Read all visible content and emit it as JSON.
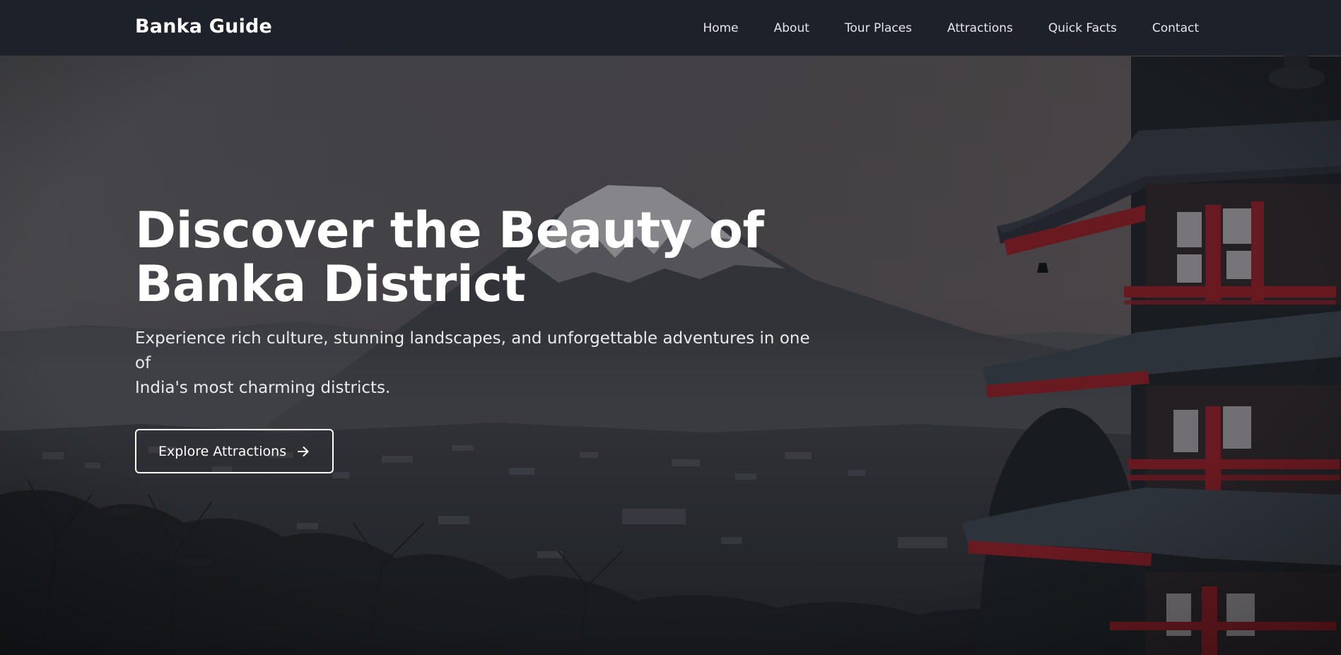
{
  "brand": {
    "name": "Banka Guide"
  },
  "nav": {
    "items": [
      {
        "label": "Home"
      },
      {
        "label": "About"
      },
      {
        "label": "Tour Places"
      },
      {
        "label": "Attractions"
      },
      {
        "label": "Quick Facts"
      },
      {
        "label": "Contact"
      }
    ]
  },
  "hero": {
    "title_line1": "Discover the Beauty of",
    "title_line2": "Banka District",
    "subtitle_line1": "Experience rich culture, stunning landscapes, and unforgettable adventures in one of",
    "subtitle_line2": "India's most charming districts.",
    "cta_label": "Explore Attractions",
    "cta_icon": "arrow-right-icon",
    "background_image": "mountain-pagoda-landscape"
  },
  "colors": {
    "navbar_bg": "#1c202a",
    "text": "#ffffff",
    "pagoda_red": "#8c1c24"
  }
}
